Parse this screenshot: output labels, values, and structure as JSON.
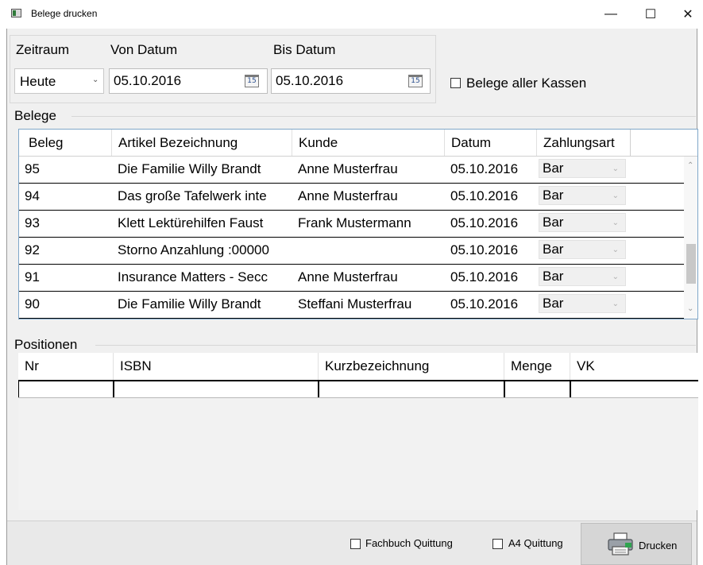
{
  "window": {
    "title": "Belege drucken",
    "minimize": "—",
    "maximize": "☐",
    "close": "✕"
  },
  "range": {
    "zeitraum_label": "Zeitraum",
    "von_label": "Von Datum",
    "bis_label": "Bis Datum",
    "zeitraum_value": "Heute",
    "von_value": "05.10.2016",
    "bis_value": "05.10.2016",
    "calendar_icon_text": "15",
    "all_registers_label": "Belege aller Kassen"
  },
  "belege": {
    "section_label": "Belege",
    "columns": [
      "Beleg",
      "Artikel Bezeichnung",
      "Kunde",
      "Datum",
      "Zahlungsart"
    ],
    "rows": [
      {
        "beleg": "95",
        "artikel": "Die Familie Willy Brandt",
        "kunde": "Anne Musterfrau",
        "datum": "05.10.2016",
        "zahlungsart": "Bar"
      },
      {
        "beleg": "94",
        "artikel": "Das große Tafelwerk inte",
        "kunde": "Anne Musterfrau",
        "datum": "05.10.2016",
        "zahlungsart": "Bar"
      },
      {
        "beleg": "93",
        "artikel": "Klett Lektürehilfen Faust",
        "kunde": "Frank Mustermann",
        "datum": "05.10.2016",
        "zahlungsart": "Bar"
      },
      {
        "beleg": "92",
        "artikel": "Storno Anzahlung :00000",
        "kunde": "",
        "datum": "05.10.2016",
        "zahlungsart": "Bar"
      },
      {
        "beleg": "91",
        "artikel": "Insurance Matters - Secc",
        "kunde": "Anne Musterfrau",
        "datum": "05.10.2016",
        "zahlungsart": "Bar"
      },
      {
        "beleg": "90",
        "artikel": "Die Familie Willy Brandt",
        "kunde": "Steffani Musterfrau",
        "datum": "05.10.2016",
        "zahlungsart": "Bar"
      }
    ]
  },
  "positionen": {
    "section_label": "Positionen",
    "columns": [
      "Nr",
      "ISBN",
      "Kurzbezeichnung",
      "Menge",
      "VK"
    ]
  },
  "footer": {
    "fachbuch_label": "Fachbuch Quittung",
    "a4_label": "A4 Quittung",
    "print_label": "Drucken"
  },
  "colors": {
    "grid_border": "#7fa7c9",
    "client_bg": "#f0f0f0",
    "button_bg": "#d6d6d6"
  },
  "icons": {
    "app": "app-icon",
    "calendar": "calendar-icon",
    "printer": "printer-icon"
  }
}
